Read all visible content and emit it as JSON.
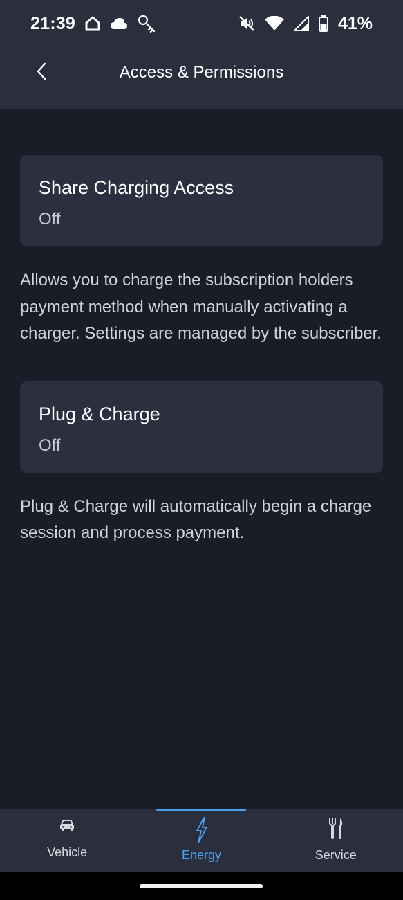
{
  "status_bar": {
    "time": "21:39",
    "battery_percent": "41%",
    "icons_left": [
      "home-icon",
      "cloud-icon",
      "key-icon"
    ],
    "icons_right": [
      "mute-icon",
      "wifi-icon",
      "signal-icon",
      "battery-icon"
    ]
  },
  "header": {
    "title": "Access & Permissions",
    "back_icon": "chevron-left-icon"
  },
  "settings": [
    {
      "title": "Share Charging Access",
      "value": "Off",
      "description": "Allows you to charge the subscription holders payment method when manually activating a charger. Settings are managed by the subscriber."
    },
    {
      "title": "Plug & Charge",
      "value": "Off",
      "description": "Plug & Charge will automatically begin a charge session and process payment."
    }
  ],
  "bottom_nav": {
    "items": [
      {
        "label": "Vehicle",
        "icon": "car-icon",
        "active": false
      },
      {
        "label": "Energy",
        "icon": "lightning-icon",
        "active": true
      },
      {
        "label": "Service",
        "icon": "tools-icon",
        "active": false
      }
    ]
  },
  "colors": {
    "background": "#1a1c28",
    "surface": "#2b2e3d",
    "card": "#2c2f40",
    "accent": "#4aa3f0"
  }
}
